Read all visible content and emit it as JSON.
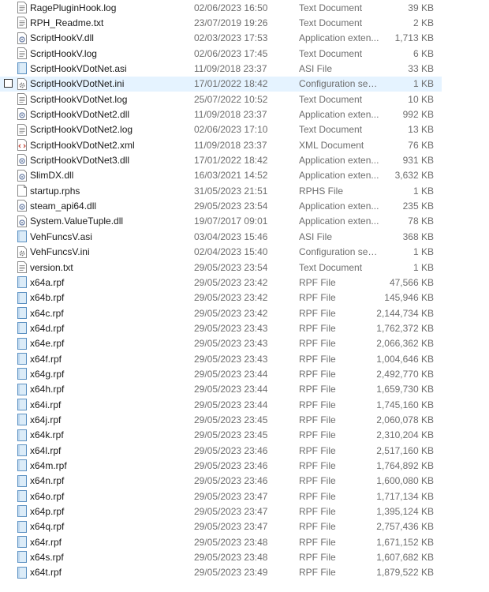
{
  "files": [
    {
      "name": "RagePluginHook.log",
      "date": "02/06/2023 16:50",
      "type": "Text Document",
      "size": "39 KB",
      "icon": "text-file-icon"
    },
    {
      "name": "RPH_Readme.txt",
      "date": "23/07/2019 19:26",
      "type": "Text Document",
      "size": "2 KB",
      "icon": "text-file-icon"
    },
    {
      "name": "ScriptHookV.dll",
      "date": "02/03/2023 17:53",
      "type": "Application exten...",
      "size": "1,713 KB",
      "icon": "dll-file-icon"
    },
    {
      "name": "ScriptHookV.log",
      "date": "02/06/2023 17:45",
      "type": "Text Document",
      "size": "6 KB",
      "icon": "text-file-icon"
    },
    {
      "name": "ScriptHookVDotNet.asi",
      "date": "11/09/2018 23:37",
      "type": "ASI File",
      "size": "33 KB",
      "icon": "generic-file-icon"
    },
    {
      "name": "ScriptHookVDotNet.ini",
      "date": "17/01/2022 18:42",
      "type": "Configuration sett...",
      "size": "1 KB",
      "icon": "config-file-icon",
      "hover": true
    },
    {
      "name": "ScriptHookVDotNet.log",
      "date": "25/07/2022 10:52",
      "type": "Text Document",
      "size": "10 KB",
      "icon": "text-file-icon"
    },
    {
      "name": "ScriptHookVDotNet2.dll",
      "date": "11/09/2018 23:37",
      "type": "Application exten...",
      "size": "992 KB",
      "icon": "dll-file-icon"
    },
    {
      "name": "ScriptHookVDotNet2.log",
      "date": "02/06/2023 17:10",
      "type": "Text Document",
      "size": "13 KB",
      "icon": "text-file-icon"
    },
    {
      "name": "ScriptHookVDotNet2.xml",
      "date": "11/09/2018 23:37",
      "type": "XML Document",
      "size": "76 KB",
      "icon": "xml-file-icon"
    },
    {
      "name": "ScriptHookVDotNet3.dll",
      "date": "17/01/2022 18:42",
      "type": "Application exten...",
      "size": "931 KB",
      "icon": "dll-file-icon"
    },
    {
      "name": "SlimDX.dll",
      "date": "16/03/2021 14:52",
      "type": "Application exten...",
      "size": "3,632 KB",
      "icon": "dll-file-icon"
    },
    {
      "name": "startup.rphs",
      "date": "31/05/2023 21:51",
      "type": "RPHS File",
      "size": "1 KB",
      "icon": "blank-file-icon"
    },
    {
      "name": "steam_api64.dll",
      "date": "29/05/2023 23:54",
      "type": "Application exten...",
      "size": "235 KB",
      "icon": "dll-file-icon"
    },
    {
      "name": "System.ValueTuple.dll",
      "date": "19/07/2017 09:01",
      "type": "Application exten...",
      "size": "78 KB",
      "icon": "dll-file-icon"
    },
    {
      "name": "VehFuncsV.asi",
      "date": "03/04/2023 15:46",
      "type": "ASI File",
      "size": "368 KB",
      "icon": "generic-file-icon"
    },
    {
      "name": "VehFuncsV.ini",
      "date": "02/04/2023 15:40",
      "type": "Configuration sett...",
      "size": "1 KB",
      "icon": "config-file-icon"
    },
    {
      "name": "version.txt",
      "date": "29/05/2023 23:54",
      "type": "Text Document",
      "size": "1 KB",
      "icon": "text-file-icon"
    },
    {
      "name": "x64a.rpf",
      "date": "29/05/2023 23:42",
      "type": "RPF File",
      "size": "47,566 KB",
      "icon": "generic-file-icon"
    },
    {
      "name": "x64b.rpf",
      "date": "29/05/2023 23:42",
      "type": "RPF File",
      "size": "145,946 KB",
      "icon": "generic-file-icon"
    },
    {
      "name": "x64c.rpf",
      "date": "29/05/2023 23:42",
      "type": "RPF File",
      "size": "2,144,734 KB",
      "icon": "generic-file-icon"
    },
    {
      "name": "x64d.rpf",
      "date": "29/05/2023 23:43",
      "type": "RPF File",
      "size": "1,762,372 KB",
      "icon": "generic-file-icon"
    },
    {
      "name": "x64e.rpf",
      "date": "29/05/2023 23:43",
      "type": "RPF File",
      "size": "2,066,362 KB",
      "icon": "generic-file-icon"
    },
    {
      "name": "x64f.rpf",
      "date": "29/05/2023 23:43",
      "type": "RPF File",
      "size": "1,004,646 KB",
      "icon": "generic-file-icon"
    },
    {
      "name": "x64g.rpf",
      "date": "29/05/2023 23:44",
      "type": "RPF File",
      "size": "2,492,770 KB",
      "icon": "generic-file-icon"
    },
    {
      "name": "x64h.rpf",
      "date": "29/05/2023 23:44",
      "type": "RPF File",
      "size": "1,659,730 KB",
      "icon": "generic-file-icon"
    },
    {
      "name": "x64i.rpf",
      "date": "29/05/2023 23:44",
      "type": "RPF File",
      "size": "1,745,160 KB",
      "icon": "generic-file-icon"
    },
    {
      "name": "x64j.rpf",
      "date": "29/05/2023 23:45",
      "type": "RPF File",
      "size": "2,060,078 KB",
      "icon": "generic-file-icon"
    },
    {
      "name": "x64k.rpf",
      "date": "29/05/2023 23:45",
      "type": "RPF File",
      "size": "2,310,204 KB",
      "icon": "generic-file-icon"
    },
    {
      "name": "x64l.rpf",
      "date": "29/05/2023 23:46",
      "type": "RPF File",
      "size": "2,517,160 KB",
      "icon": "generic-file-icon"
    },
    {
      "name": "x64m.rpf",
      "date": "29/05/2023 23:46",
      "type": "RPF File",
      "size": "1,764,892 KB",
      "icon": "generic-file-icon"
    },
    {
      "name": "x64n.rpf",
      "date": "29/05/2023 23:46",
      "type": "RPF File",
      "size": "1,600,080 KB",
      "icon": "generic-file-icon"
    },
    {
      "name": "x64o.rpf",
      "date": "29/05/2023 23:47",
      "type": "RPF File",
      "size": "1,717,134 KB",
      "icon": "generic-file-icon"
    },
    {
      "name": "x64p.rpf",
      "date": "29/05/2023 23:47",
      "type": "RPF File",
      "size": "1,395,124 KB",
      "icon": "generic-file-icon"
    },
    {
      "name": "x64q.rpf",
      "date": "29/05/2023 23:47",
      "type": "RPF File",
      "size": "2,757,436 KB",
      "icon": "generic-file-icon"
    },
    {
      "name": "x64r.rpf",
      "date": "29/05/2023 23:48",
      "type": "RPF File",
      "size": "1,671,152 KB",
      "icon": "generic-file-icon"
    },
    {
      "name": "x64s.rpf",
      "date": "29/05/2023 23:48",
      "type": "RPF File",
      "size": "1,607,682 KB",
      "icon": "generic-file-icon"
    },
    {
      "name": "x64t.rpf",
      "date": "29/05/2023 23:49",
      "type": "RPF File",
      "size": "1,879,522 KB",
      "icon": "generic-file-icon"
    }
  ],
  "colors": {
    "hover_bg": "#e5f3ff",
    "meta_text": "#6d6d6d"
  }
}
